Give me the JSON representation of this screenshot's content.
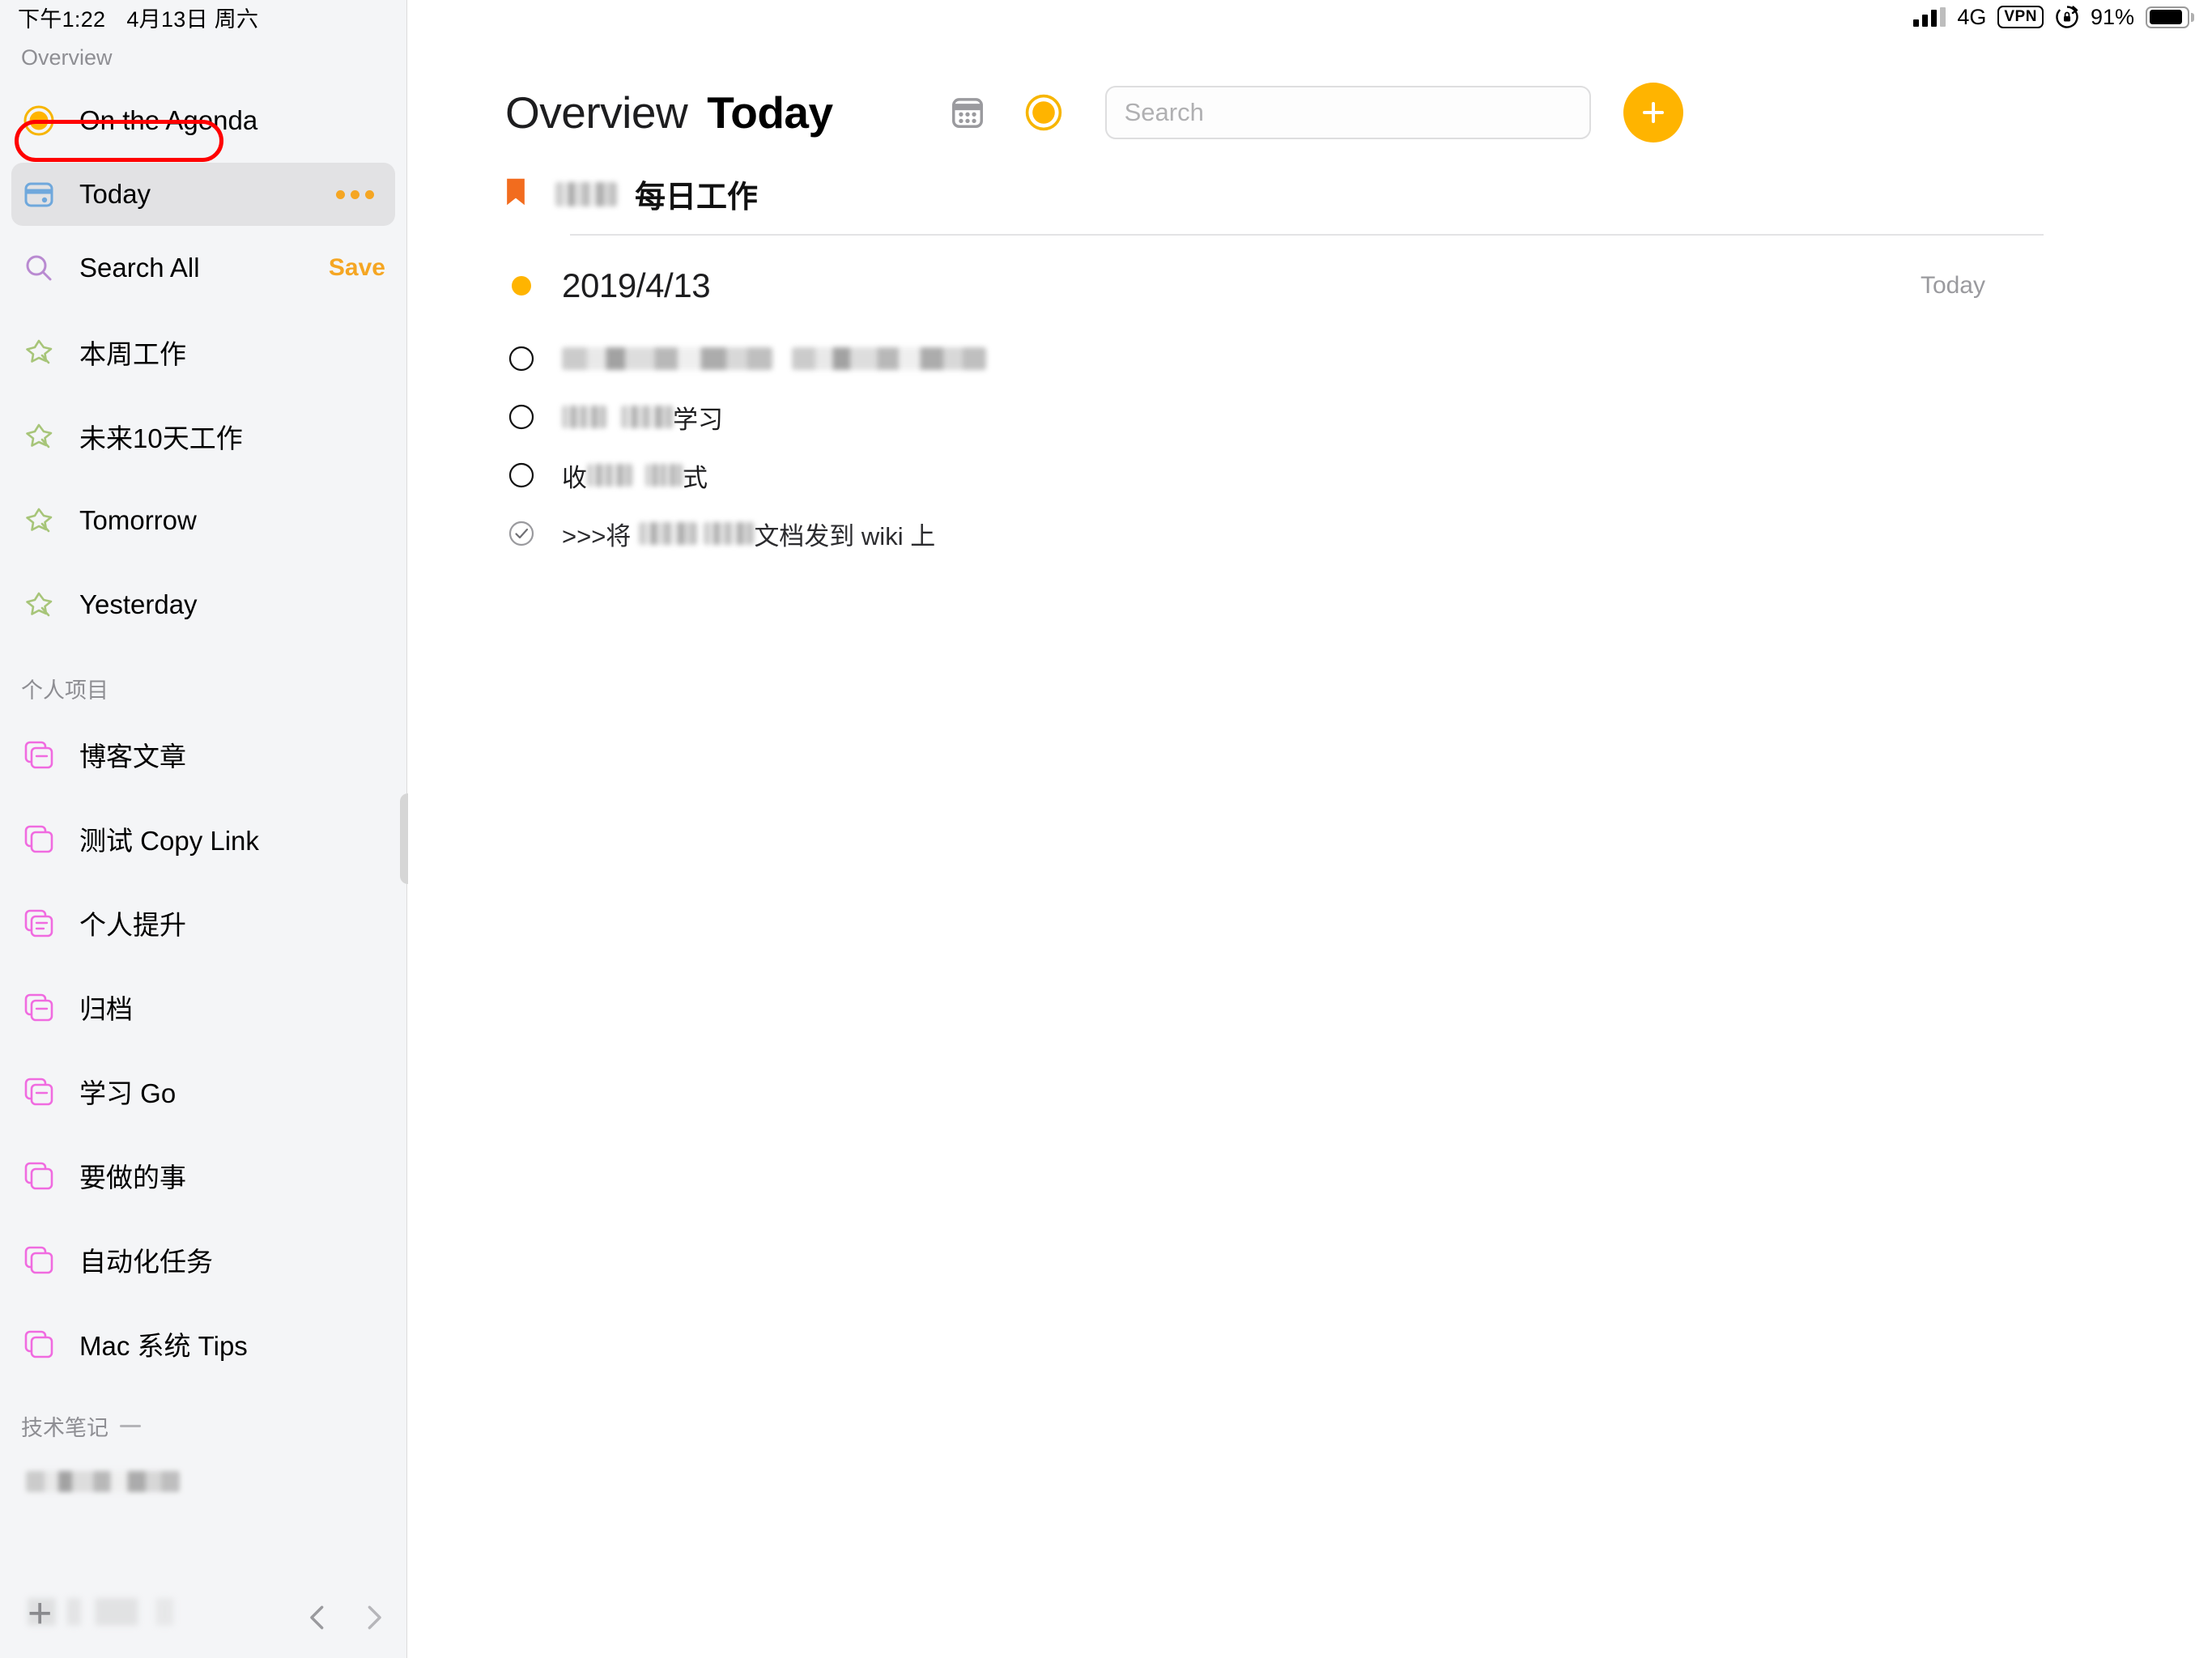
{
  "status_bar": {
    "time": "下午1:22",
    "date": "4月13日 周六",
    "network": "4G",
    "vpn": "VPN",
    "battery_percent": "91%",
    "battery_level": 91,
    "icons": [
      "signal-bars-icon",
      "vpn-badge-icon",
      "rotation-lock-icon",
      "battery-icon"
    ]
  },
  "sidebar": {
    "sections": [
      {
        "title": "Overview",
        "collapsible_dash": false,
        "items": [
          {
            "label": "On the Agenda",
            "icon": "agenda-circle-icon",
            "selected": false,
            "trailing": ""
          },
          {
            "label": "Today",
            "icon": "calendar-icon",
            "selected": true,
            "trailing": "more-dots"
          },
          {
            "label": "Search All",
            "icon": "search-icon",
            "selected": false,
            "trailing": "Save"
          },
          {
            "label": "本周工作",
            "icon": "pin-icon",
            "selected": false,
            "trailing": ""
          },
          {
            "label": "未来10天工作",
            "icon": "pin-icon",
            "selected": false,
            "trailing": ""
          },
          {
            "label": "Tomorrow",
            "icon": "pin-icon",
            "selected": false,
            "trailing": ""
          },
          {
            "label": "Yesterday",
            "icon": "pin-icon",
            "selected": false,
            "trailing": ""
          }
        ]
      },
      {
        "title": "个人项目",
        "collapsible_dash": false,
        "items": [
          {
            "label": "博客文章",
            "icon": "project-icon",
            "selected": false,
            "trailing": ""
          },
          {
            "label": "测试 Copy Link",
            "icon": "project-icon",
            "selected": false,
            "trailing": ""
          },
          {
            "label": "个人提升",
            "icon": "project-icon",
            "selected": false,
            "trailing": ""
          },
          {
            "label": "归档",
            "icon": "project-icon",
            "selected": false,
            "trailing": ""
          },
          {
            "label": "学习 Go",
            "icon": "project-icon",
            "selected": false,
            "trailing": ""
          },
          {
            "label": "要做的事",
            "icon": "project-icon",
            "selected": false,
            "trailing": ""
          },
          {
            "label": "自动化任务",
            "icon": "project-icon",
            "selected": false,
            "trailing": ""
          },
          {
            "label": "Mac 系统 Tips",
            "icon": "project-icon",
            "selected": false,
            "trailing": ""
          }
        ]
      },
      {
        "title": "技术笔记",
        "collapsible_dash": true,
        "items": [
          {
            "label": "",
            "icon": "",
            "selected": false,
            "trailing": "",
            "redacted": true
          }
        ]
      }
    ],
    "save_label": "Save",
    "bottom_bar": {
      "add_icon": "plus-icon",
      "back_icon": "chevron-left-icon",
      "forward_icon": "chevron-right-icon"
    }
  },
  "main": {
    "breadcrumb": {
      "parent": "Overview",
      "current": "Today"
    },
    "toolbar": {
      "calendar_icon": "calendar-icon",
      "agenda_icon": "agenda-circle-icon",
      "add_icon": "plus-icon"
    },
    "search": {
      "placeholder": "Search",
      "value": ""
    },
    "note": {
      "flag_icon": "bookmark-icon",
      "title_redacted": true,
      "title": "每日工作"
    },
    "date_group": {
      "dot_color": "#ffb400",
      "date": "2019/4/13",
      "relative_label": "Today"
    },
    "tasks": [
      {
        "text": "",
        "redacted": true,
        "done": false,
        "checkbox_icon": "circle-unchecked-icon"
      },
      {
        "text": "学习",
        "redacted": true,
        "done": false,
        "checkbox_icon": "circle-unchecked-icon"
      },
      {
        "text_before": "收",
        "text": "式",
        "redacted": true,
        "done": false,
        "checkbox_icon": "circle-unchecked-icon"
      },
      {
        "text_before": ">>>将",
        "text": "文档发到 wiki 上",
        "redacted": true,
        "done": true,
        "checkbox_icon": "circle-checked-icon"
      }
    ]
  },
  "colors": {
    "accent_yellow": "#ffb400",
    "save_yellow": "#f5a623",
    "pin_green": "#a7c579",
    "project_pink": "#f06be0",
    "search_purple": "#b98ad1",
    "calendar_blue": "#6fa8dc",
    "flag_orange": "#f26c1e",
    "annotation_red": "#ff0000",
    "sidebar_bg": "#f4f5f7",
    "selected_bg": "#e2e2e4"
  }
}
